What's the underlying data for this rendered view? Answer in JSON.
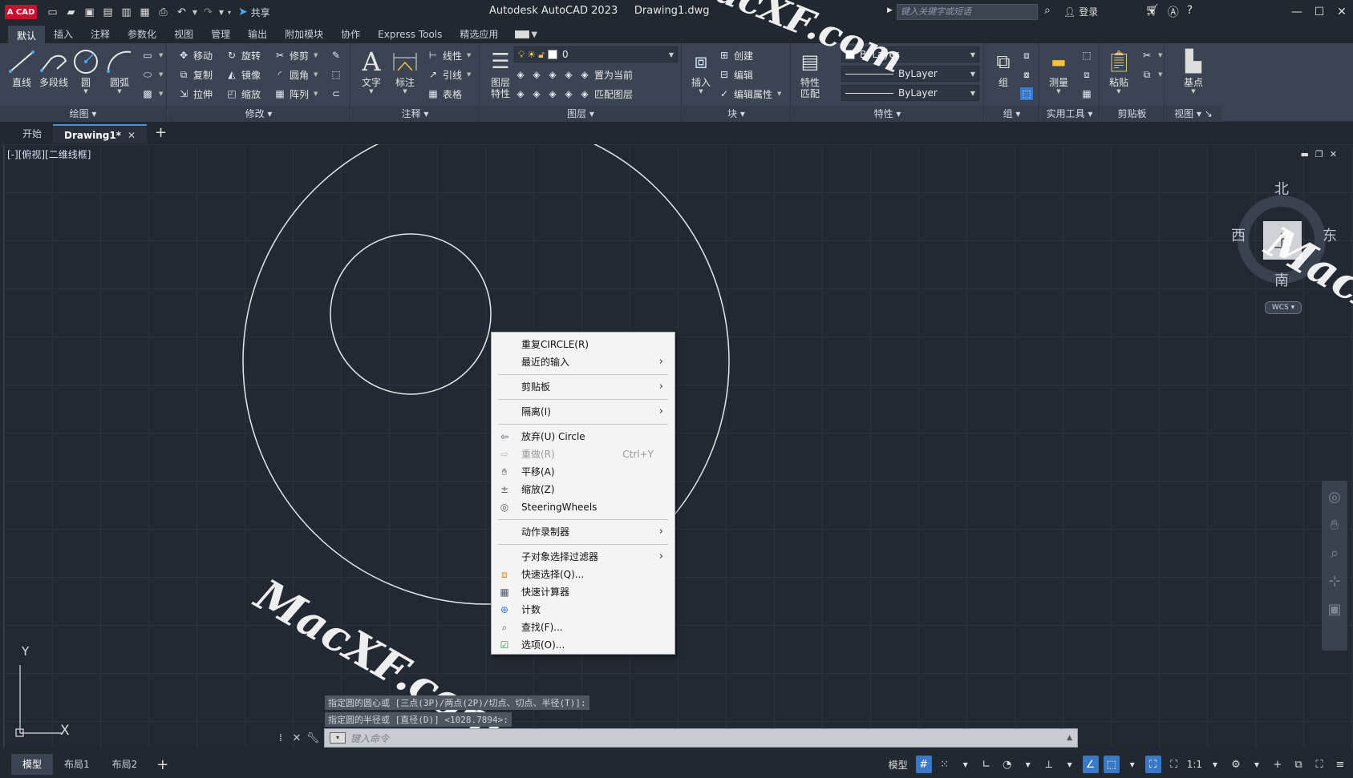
{
  "titlebar": {
    "logo": "A CAD",
    "share_label": "共享",
    "app_name": "Autodesk AutoCAD 2023",
    "document": "Drawing1.dwg",
    "search_placeholder": "键入关键字或短语",
    "login_label": "登录"
  },
  "ribbon_tabs": [
    "默认",
    "插入",
    "注释",
    "参数化",
    "视图",
    "管理",
    "输出",
    "附加模块",
    "协作",
    "Express Tools",
    "精选应用"
  ],
  "ribbon": {
    "draw": {
      "title": "绘图",
      "line": "直线",
      "polyline": "多段线",
      "circle": "圆",
      "arc": "圆弧"
    },
    "modify": {
      "title": "修改",
      "move": "移动",
      "rotate": "旋转",
      "trim": "修剪",
      "copy": "复制",
      "mirror": "镜像",
      "fillet": "圆角",
      "stretch": "拉伸",
      "scale": "缩放",
      "array": "阵列"
    },
    "annotation": {
      "title": "注释",
      "text": "文字",
      "dimension": "标注",
      "linear": "线性",
      "leader": "引线",
      "table": "表格"
    },
    "layers": {
      "title": "图层",
      "layer_props_1": "图层",
      "layer_props_2": "特性",
      "current_layer": "0",
      "set_current": "置为当前",
      "match_layer": "匹配图层"
    },
    "block": {
      "title": "块",
      "insert": "插入",
      "create": "创建",
      "edit": "编辑",
      "edit_attr": "编辑属性"
    },
    "properties": {
      "title": "特性",
      "match_1": "特性",
      "match_2": "匹配",
      "color": "ByLayer",
      "linetype": "ByLayer",
      "lineweight": "ByLayer"
    },
    "groups": {
      "title": "组",
      "group": "组"
    },
    "utilities": {
      "title": "实用工具",
      "measure": "测量"
    },
    "clipboard": {
      "title": "剪贴板",
      "paste": "粘贴"
    },
    "view": {
      "title": "视图",
      "base": "基点"
    }
  },
  "doc_tabs": {
    "start": "开始",
    "drawing": "Drawing1*"
  },
  "viewport": {
    "label": "[-][俯视][二维线框]",
    "viewcube": {
      "north": "北",
      "south": "南",
      "east": "东",
      "west": "西",
      "top": "上",
      "wcs": "WCS"
    },
    "ucs_y": "Y",
    "ucs_x": "X"
  },
  "command": {
    "history": [
      "指定圆的圆心或 [三点(3P)/两点(2P)/切点、切点、半径(T)]:",
      "指定圆的半径或 [直径(D)] <1028.7894>:"
    ],
    "placeholder": "键入命令"
  },
  "context_menu": {
    "items": [
      {
        "label": "重复CIRCLE(R)",
        "icon": "",
        "submenu": false,
        "disabled": false
      },
      {
        "label": "最近的输入",
        "icon": "",
        "submenu": true,
        "disabled": false
      },
      {
        "sep": true
      },
      {
        "label": "剪贴板",
        "icon": "",
        "submenu": true,
        "disabled": false
      },
      {
        "sep": true
      },
      {
        "label": "隔离(I)",
        "icon": "",
        "submenu": true,
        "disabled": false
      },
      {
        "sep": true
      },
      {
        "label": "放弃(U) Circle",
        "icon": "undo-icon",
        "submenu": false,
        "disabled": false
      },
      {
        "label": "重做(R)",
        "icon": "redo-icon",
        "submenu": false,
        "disabled": true,
        "shortcut": "Ctrl+Y"
      },
      {
        "label": "平移(A)",
        "icon": "pan-hand-icon",
        "submenu": false,
        "disabled": false
      },
      {
        "label": "缩放(Z)",
        "icon": "zoom-icon",
        "submenu": false,
        "disabled": false
      },
      {
        "label": "SteeringWheels",
        "icon": "steering-wheel-icon",
        "submenu": false,
        "disabled": false
      },
      {
        "sep": true
      },
      {
        "label": "动作录制器",
        "icon": "",
        "submenu": true,
        "disabled": false
      },
      {
        "sep": true
      },
      {
        "label": "子对象选择过滤器",
        "icon": "",
        "submenu": true,
        "disabled": false
      },
      {
        "label": "快速选择(Q)...",
        "icon": "quick-select-icon",
        "submenu": false,
        "disabled": false
      },
      {
        "label": "快速计算器",
        "icon": "calculator-icon",
        "submenu": false,
        "disabled": false
      },
      {
        "label": "计数",
        "icon": "count-icon",
        "submenu": false,
        "disabled": false
      },
      {
        "label": "查找(F)...",
        "icon": "find-icon",
        "submenu": false,
        "disabled": false
      },
      {
        "label": "选项(O)...",
        "icon": "options-check-icon",
        "submenu": false,
        "disabled": false
      }
    ]
  },
  "status": {
    "tabs": [
      "模型",
      "布局1",
      "布局2"
    ],
    "model_label": "模型",
    "scale": "1:1"
  },
  "watermark": "MacXF.com",
  "colors": {
    "background": "#212830",
    "ribbon": "#3b4453",
    "canvas": "#222933",
    "accent": "#3a78c8",
    "autocad_red": "#c8102e"
  }
}
